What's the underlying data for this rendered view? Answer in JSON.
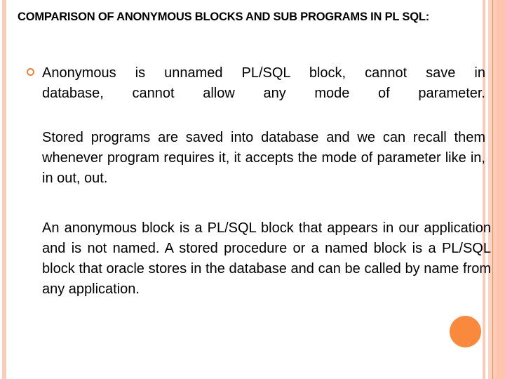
{
  "slide": {
    "title": "COMPARISON OF ANONYMOUS BLOCKS AND SUB PROGRAMS IN PL SQL:",
    "bullet_icon": "ring-bullet-icon",
    "paragraphs": [
      {
        "lines": [
          "Anonymous is unnamed PL/SQL block, cannot save in",
          "database, cannot allow any mode of parameter."
        ]
      },
      {
        "text": "Stored programs are saved into database and we can recall them whenever program requires it, it accepts the mode of parameter like in, in out, out."
      },
      {
        "text": "An anonymous block is a PL/SQL block that appears in our application and is not named. A stored procedure or a named block is a PL/SQL block that oracle stores in the database and can be called by name from any application."
      }
    ],
    "decoration": {
      "accent_color": "#f98a3d",
      "stripe_color": "#fbd0be"
    }
  }
}
